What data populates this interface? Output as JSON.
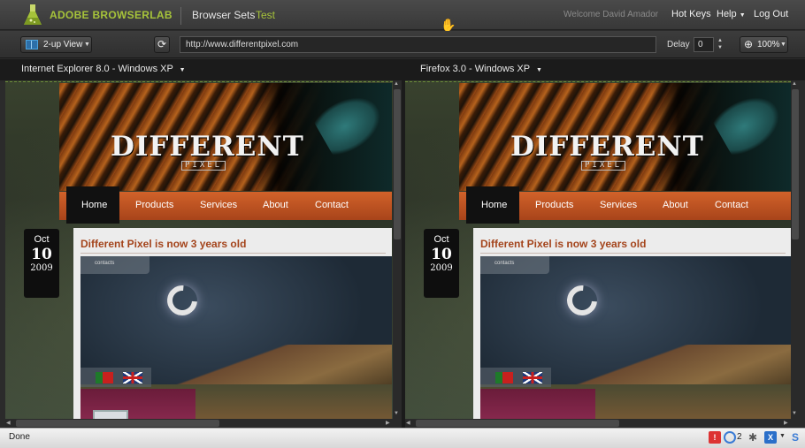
{
  "app": {
    "name": "ADOBE BROWSERLAB",
    "nav_browser_sets": "Browser Sets",
    "current_set": "Test",
    "welcome": "Welcome David Amador",
    "hot_keys": "Hot Keys",
    "help": "Help",
    "log_out": "Log Out"
  },
  "toolbar": {
    "view_mode": "2-up View",
    "url": "http://www.differentpixel.com",
    "delay_label": "Delay",
    "delay_value": "0",
    "zoom": "100%"
  },
  "browsers": {
    "left": "Internet Explorer 8.0 - Windows XP",
    "right": "Firefox 3.0 - Windows XP"
  },
  "site": {
    "logo": "DIFFERENT",
    "logo_sub": "PIXEL",
    "nav": [
      "Home",
      "Products",
      "Services",
      "About",
      "Contact"
    ],
    "date_month": "Oct",
    "date_day": "10",
    "date_year": "2009",
    "post_title": "Different Pixel is now 3 years old",
    "contacts_tab": "contacts"
  },
  "status": {
    "text": "Done",
    "chat_count": "2"
  },
  "colors": {
    "brand_green": "#a6c33a",
    "nav_orange": "#c4542a",
    "post_title": "#a4441b"
  }
}
